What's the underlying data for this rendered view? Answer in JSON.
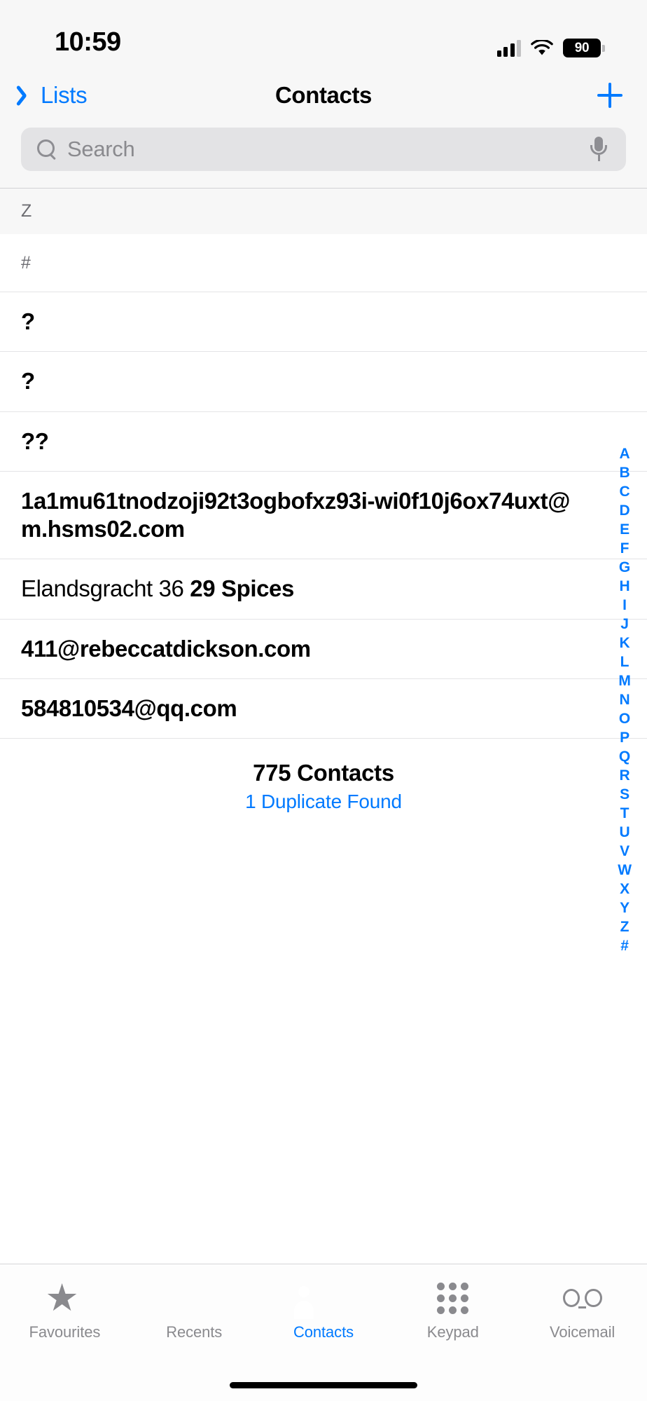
{
  "status_bar": {
    "time": "10:59",
    "battery_percent": "90",
    "cellular_icon": "cellular-signal-icon",
    "wifi_icon": "wifi-icon",
    "battery_icon": "battery-icon"
  },
  "nav_bar": {
    "back_label": "Lists",
    "back_icon": "chevron-left-icon",
    "title": "Contacts",
    "add_icon": "plus-icon"
  },
  "search": {
    "placeholder": "Search",
    "value": "",
    "search_icon": "search-icon",
    "mic_icon": "microphone-icon"
  },
  "list": {
    "sticky_section_header": "Z",
    "section_label": "#",
    "contacts": [
      {
        "display": "?",
        "bold": true
      },
      {
        "display": "?",
        "bold": true
      },
      {
        "display": "??",
        "bold": true
      },
      {
        "display": "1a1mu61tnodzoji92t3ogbofxz93i-wi0f10j6ox74uxt@m.hsms02.com",
        "bold": true
      },
      {
        "first": "Elandsgracht 36",
        "last": "29 Spices",
        "bold": false
      },
      {
        "display": "411@rebeccatdickson.com",
        "bold": true
      },
      {
        "display": "584810534@qq.com",
        "bold": true
      }
    ],
    "footer_count": "775 Contacts",
    "footer_duplicates": "1 Duplicate Found"
  },
  "index_rail": {
    "letters": [
      "A",
      "B",
      "C",
      "D",
      "E",
      "F",
      "G",
      "H",
      "I",
      "J",
      "K",
      "L",
      "M",
      "N",
      "O",
      "P",
      "Q",
      "R",
      "S",
      "T",
      "U",
      "V",
      "W",
      "X",
      "Y",
      "Z",
      "#"
    ]
  },
  "tab_bar": {
    "items": [
      {
        "label": "Favourites",
        "icon": "star-icon",
        "active": false
      },
      {
        "label": "Recents",
        "icon": "clock-icon",
        "active": false
      },
      {
        "label": "Contacts",
        "icon": "person-circle-icon",
        "active": true
      },
      {
        "label": "Keypad",
        "icon": "keypad-icon",
        "active": false
      },
      {
        "label": "Voicemail",
        "icon": "voicemail-icon",
        "active": false
      }
    ]
  },
  "colors": {
    "accent_blue": "#007aff",
    "secondary_gray": "#8a8a8e",
    "chrome_bg": "#f7f7f7"
  }
}
